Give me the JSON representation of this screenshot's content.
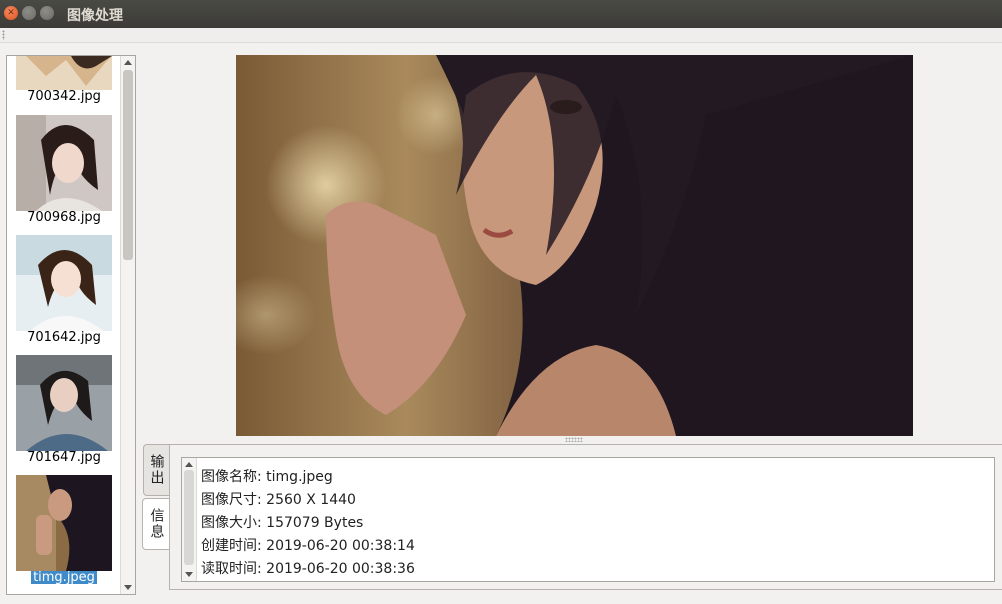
{
  "window": {
    "title": "图像处理"
  },
  "thumbnails": [
    {
      "filename": "700342.jpg",
      "selected": false
    },
    {
      "filename": "700968.jpg",
      "selected": false
    },
    {
      "filename": "701642.jpg",
      "selected": false
    },
    {
      "filename": "701647.jpg",
      "selected": false
    },
    {
      "filename": "timg.jpeg",
      "selected": true
    }
  ],
  "tabs": [
    {
      "label": "输出"
    },
    {
      "label": "信息"
    }
  ],
  "info": {
    "lines": [
      "图像名称: timg.jpeg",
      "图像尺寸: 2560 X 1440",
      "图像大小: 157079 Bytes",
      "创建时间: 2019-06-20 00:38:14",
      "读取时间: 2019-06-20 00:38:36"
    ]
  },
  "colors": {
    "titlebar": "#3c3b37",
    "selection": "#3f8ac9",
    "close_button": "#e0521f"
  }
}
